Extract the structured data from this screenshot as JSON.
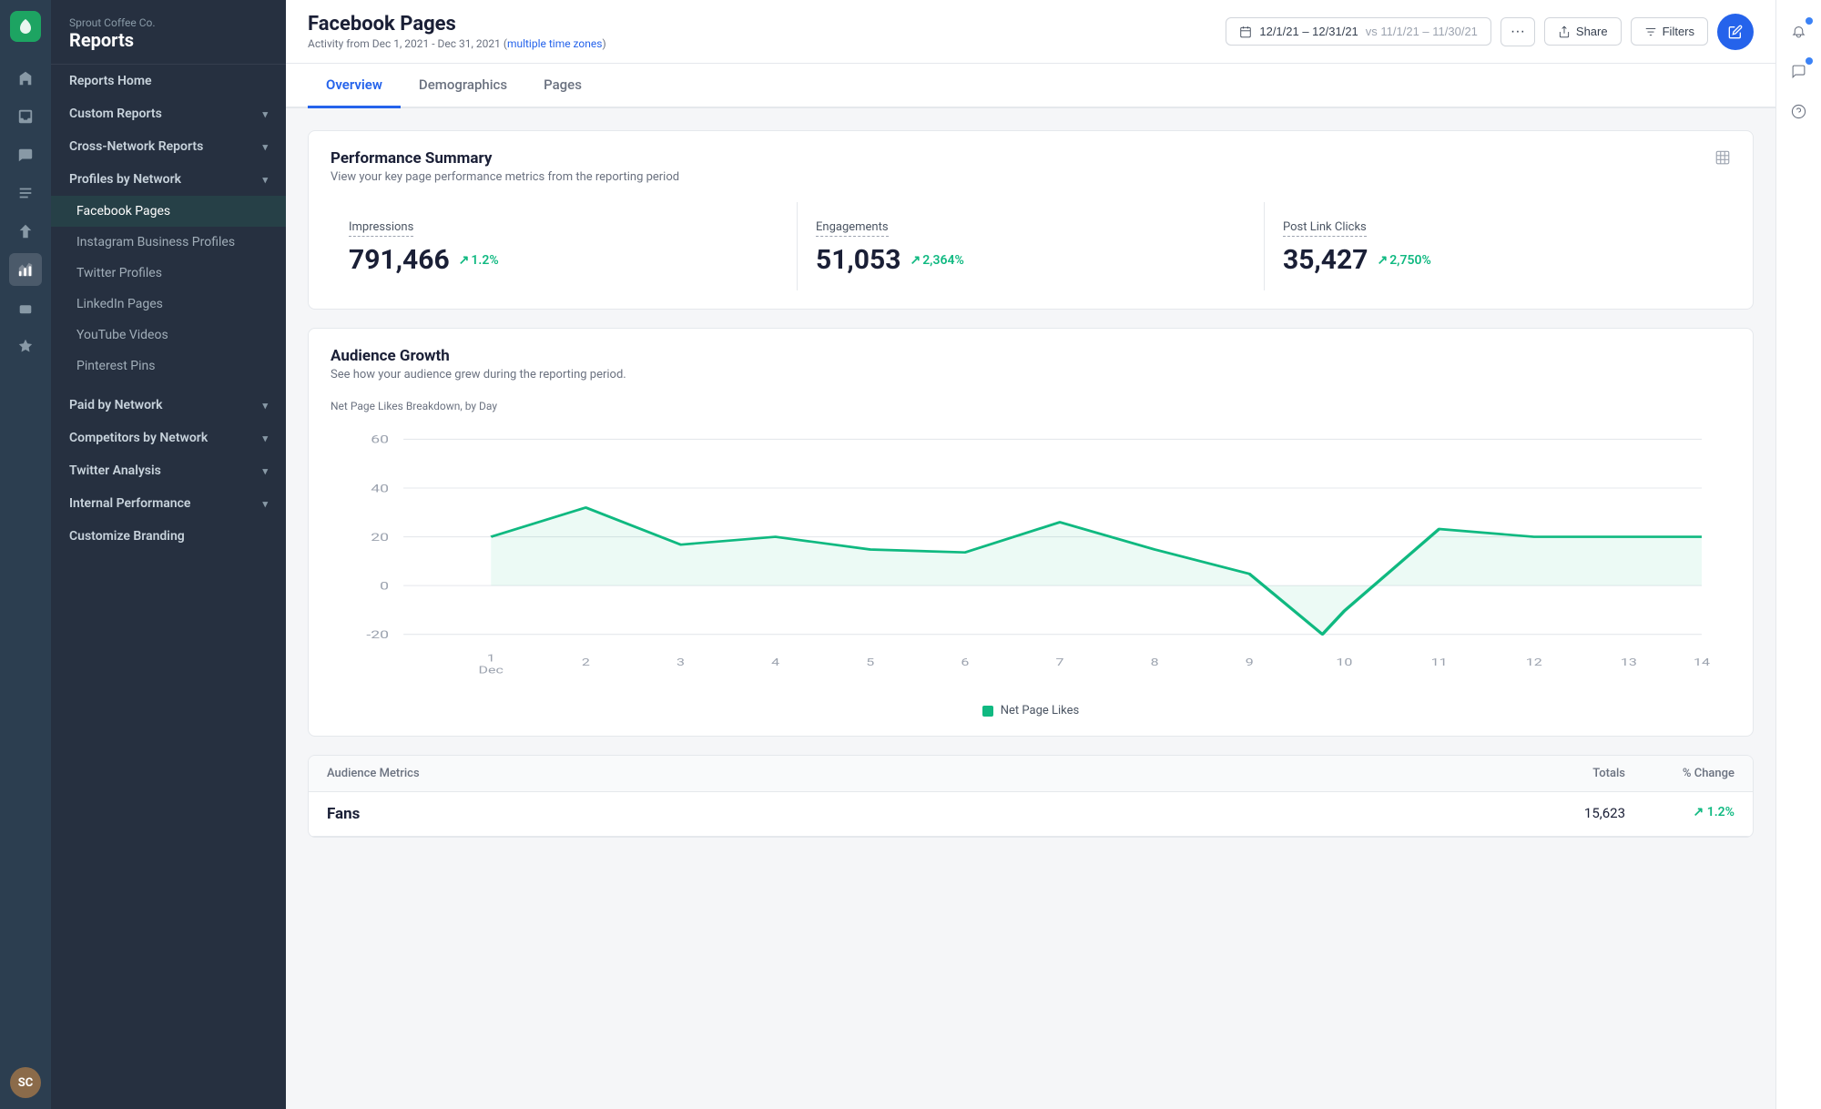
{
  "company": "Sprout Coffee Co.",
  "app_title": "Reports",
  "page": {
    "title": "Facebook Pages",
    "subtitle": "Activity from Dec 1, 2021 - Dec 31, 2021",
    "subtitle_highlight": "multiple time zones",
    "date_range": "12/1/21 – 12/31/21",
    "compare_range": "vs 11/1/21 – 11/30/21"
  },
  "tabs": [
    {
      "label": "Overview",
      "active": true
    },
    {
      "label": "Demographics",
      "active": false
    },
    {
      "label": "Pages",
      "active": false
    }
  ],
  "buttons": {
    "share": "Share",
    "filters": "Filters",
    "more": "···"
  },
  "performance_summary": {
    "title": "Performance Summary",
    "subtitle": "View your key page performance metrics from the reporting period",
    "metrics": [
      {
        "label": "Impressions",
        "value": "791,466",
        "change": "1.2%"
      },
      {
        "label": "Engagements",
        "value": "51,053",
        "change": "2,364%"
      },
      {
        "label": "Post Link Clicks",
        "value": "35,427",
        "change": "2,750%"
      }
    ]
  },
  "audience_growth": {
    "title": "Audience Growth",
    "subtitle": "See how your audience grew during the reporting period.",
    "chart_label": "Net Page Likes Breakdown, by Day",
    "legend": "Net Page Likes",
    "y_axis": [
      "60",
      "40",
      "20",
      "0",
      "-20"
    ],
    "x_axis": [
      "1\nDec",
      "2",
      "3",
      "4",
      "5",
      "6",
      "7",
      "8",
      "9",
      "10",
      "11",
      "12",
      "13",
      "14"
    ]
  },
  "audience_metrics": {
    "title": "Audience Metrics",
    "col_totals": "Totals",
    "col_change": "% Change",
    "rows": [
      {
        "name": "Fans",
        "total": "15,623",
        "change": "↗ 1.2%"
      }
    ]
  },
  "sidebar": {
    "items": [
      {
        "label": "Reports Home",
        "type": "top",
        "active": false
      },
      {
        "label": "Custom Reports",
        "type": "expandable",
        "active": false
      },
      {
        "label": "Cross-Network Reports",
        "type": "expandable",
        "active": false
      },
      {
        "label": "Profiles by Network",
        "type": "expandable",
        "active": true
      },
      {
        "label": "Paid by Network",
        "type": "expandable",
        "active": false
      },
      {
        "label": "Competitors by Network",
        "type": "expandable",
        "active": false
      },
      {
        "label": "Twitter Analysis",
        "type": "expandable",
        "active": false
      },
      {
        "label": "Internal Performance",
        "type": "expandable",
        "active": false
      },
      {
        "label": "Customize Branding",
        "type": "plain",
        "active": false
      }
    ],
    "sub_items": [
      {
        "label": "Facebook Pages",
        "active": true
      },
      {
        "label": "Instagram Business Profiles",
        "active": false
      },
      {
        "label": "Twitter Profiles",
        "active": false
      },
      {
        "label": "LinkedIn Pages",
        "active": false
      },
      {
        "label": "YouTube Videos",
        "active": false
      },
      {
        "label": "Pinterest Pins",
        "active": false
      }
    ]
  }
}
